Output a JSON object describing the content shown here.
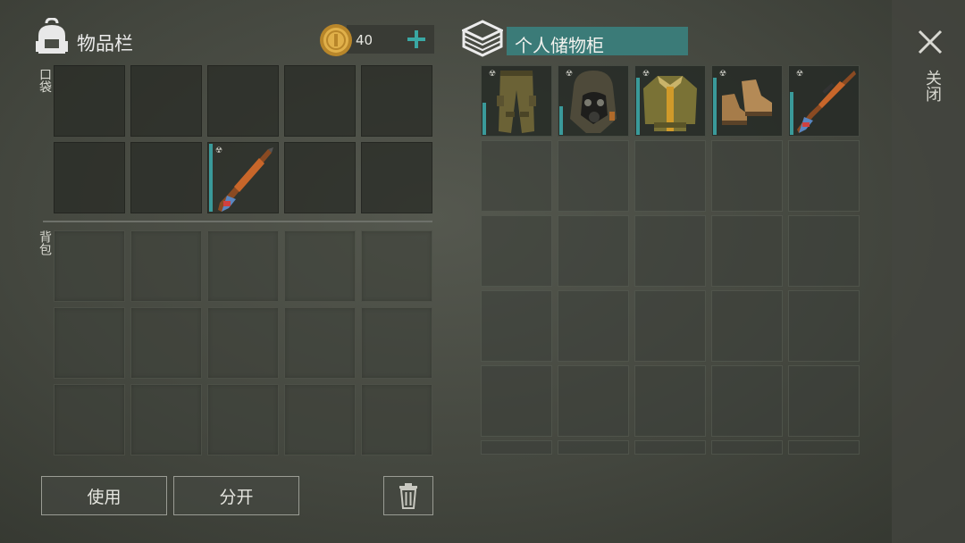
{
  "inventory": {
    "title": "物品栏",
    "coins": "40",
    "pocket_label": "口袋",
    "backpack_label": "背包"
  },
  "storage": {
    "title": "个人储物柜",
    "close_label": "关闭"
  },
  "buttons": {
    "use": "使用",
    "split": "分开"
  },
  "items": {
    "pocket_slot_8": {
      "icon": "rifle-icon",
      "durability_pct": 85,
      "radiation_marker": "☢"
    },
    "storage": [
      {
        "icon": "cargo-pants-icon",
        "durability_pct": 45
      },
      {
        "icon": "gas-mask-hood-icon",
        "durability_pct": 40
      },
      {
        "icon": "bomber-jacket-icon",
        "durability_pct": 80
      },
      {
        "icon": "boots-icon",
        "durability_pct": 80
      },
      {
        "icon": "rifle-icon",
        "durability_pct": 60
      }
    ]
  },
  "colors": {
    "accent": "#3a9a9a",
    "title_bar": "#3b7b78",
    "coin": "#d9a23a"
  }
}
